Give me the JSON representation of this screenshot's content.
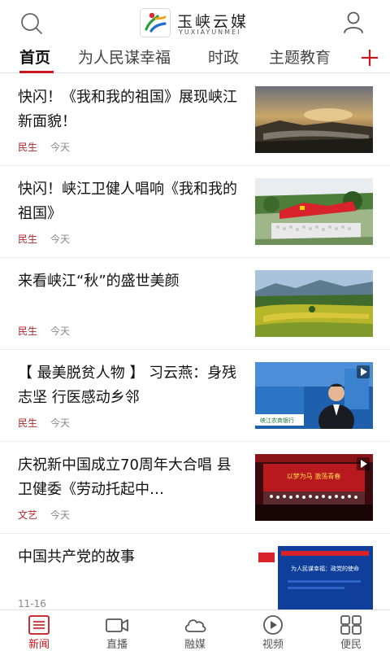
{
  "header": {
    "logo_text": "玉峡云媒",
    "logo_subtext": "YUXIAYUNMEI"
  },
  "tabs": [
    {
      "label": "首页",
      "active": true
    },
    {
      "label": "为人民谋幸福",
      "active": false
    },
    {
      "label": "时政",
      "active": false
    },
    {
      "label": "主题教育",
      "active": false
    }
  ],
  "news": [
    {
      "title": "快闪！《我和我的祖国》展现峡江新面貌！",
      "tag": "民生",
      "time": "今天",
      "thumb": "sunset-lake",
      "video": false
    },
    {
      "title": "快闪！峡江卫健人唱响《我和我的祖国》",
      "tag": "民生",
      "time": "今天",
      "thumb": "flag-crowd",
      "video": false
    },
    {
      "title": "来看峡江“秋”的盛世美颜",
      "tag": "民生",
      "time": "今天",
      "thumb": "autumn-fields",
      "video": false
    },
    {
      "title": "【 最美脱贫人物 】  习云燕：身残志坚 行医感动乡邻",
      "tag": "民生",
      "time": "今天",
      "thumb": "news-anchor",
      "video": true
    },
    {
      "title": "庆祝新中国成立70周年大合唱 县卫健委《劳动托起中…",
      "tag": "文艺",
      "time": "今天",
      "thumb": "stage-chorus",
      "video": true
    },
    {
      "title": "中国共产党的故事",
      "tag": "",
      "time": "",
      "thumb": "blue-poster",
      "video": false
    }
  ],
  "partial_time": "11-16",
  "thumb_text": {
    "anchor_bank": "峡江农商银行",
    "stage_banner": "以梦为马  激荡青春",
    "poster_line": "为人民谋幸福：政党的使命"
  },
  "bottom_nav": [
    {
      "label": "新闻",
      "icon": "news-list-icon",
      "active": true
    },
    {
      "label": "直播",
      "icon": "video-camera-icon",
      "active": false
    },
    {
      "label": "融媒",
      "icon": "cloud-icon",
      "active": false
    },
    {
      "label": "视频",
      "icon": "play-circle-icon",
      "active": false
    },
    {
      "label": "便民",
      "icon": "grid-apps-icon",
      "active": false
    }
  ],
  "colors": {
    "accent": "#c8161d",
    "tag": "#b0252b"
  }
}
